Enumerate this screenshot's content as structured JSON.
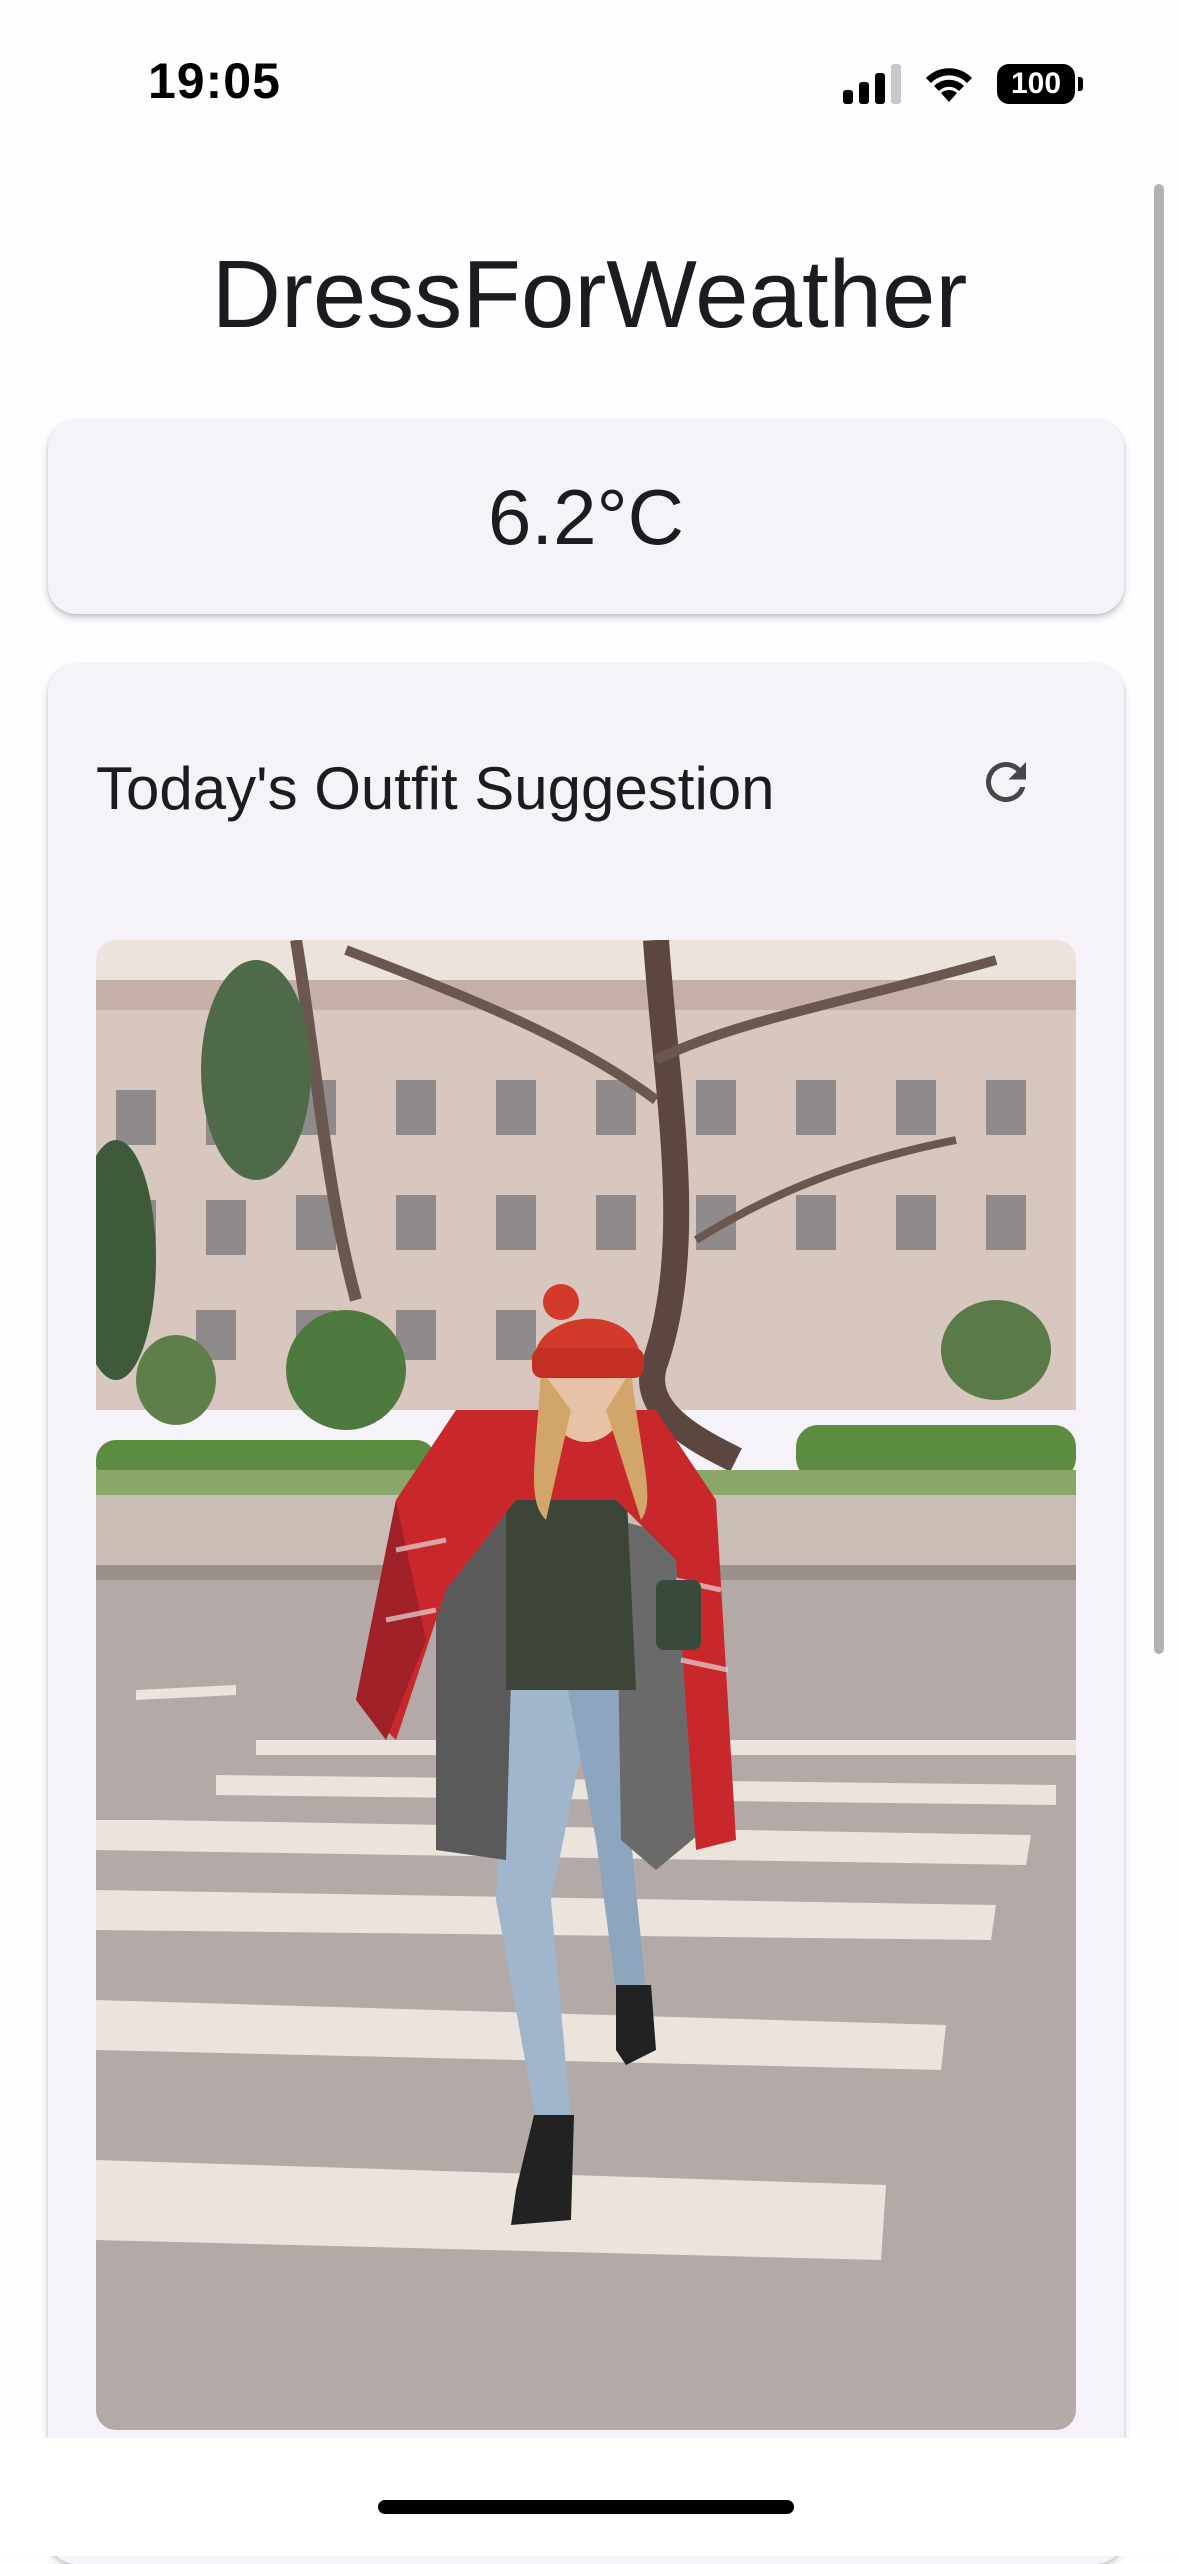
{
  "status_bar": {
    "time": "19:05",
    "battery": "100",
    "icons": [
      "signal-icon",
      "wifi-icon",
      "battery-icon"
    ]
  },
  "app": {
    "title": "DressForWeather"
  },
  "weather": {
    "temperature": "6.2°C"
  },
  "outfit": {
    "title": "Today's Outfit Suggestion",
    "refresh_icon": "refresh-icon",
    "image_alt": "Outfit suggestion photo"
  },
  "colors": {
    "card_background": "#f6f2f9",
    "text": "#1c1b1f",
    "page_background": "#fefdff"
  }
}
